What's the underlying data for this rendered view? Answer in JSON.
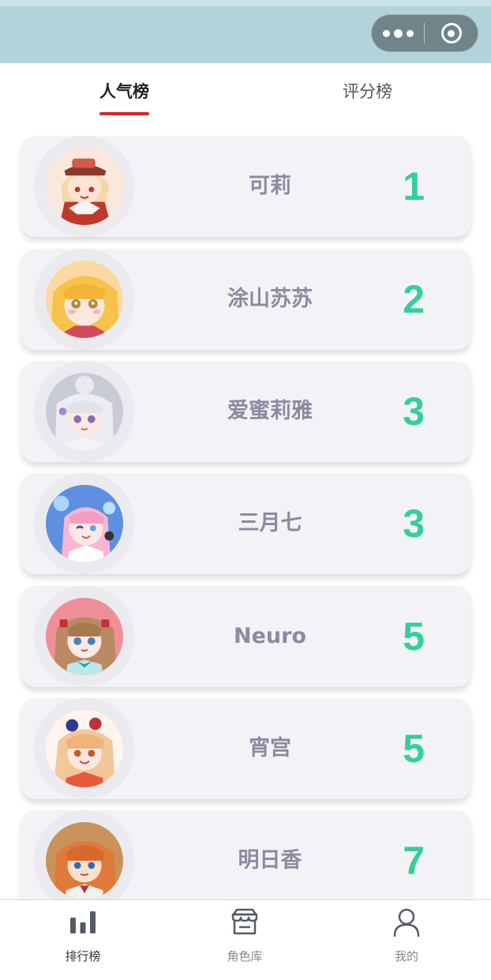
{
  "tabs": [
    {
      "label": "人气榜",
      "active": true
    },
    {
      "label": "评分榜",
      "active": false
    }
  ],
  "accent_color": "#d9232e",
  "rank_color": "#35cf98",
  "rankings": [
    {
      "name": "可莉",
      "rank": "1"
    },
    {
      "name": "涂山苏苏",
      "rank": "2"
    },
    {
      "name": "爱蜜莉雅",
      "rank": "3"
    },
    {
      "name": "三月七",
      "rank": "3"
    },
    {
      "name": "Neuro",
      "rank": "5"
    },
    {
      "name": "宵宫",
      "rank": "5"
    },
    {
      "name": "明日香",
      "rank": "7"
    }
  ],
  "tab_bar": [
    {
      "label": "排行榜",
      "icon": "bar-chart-icon",
      "active": true
    },
    {
      "label": "角色库",
      "icon": "store-icon",
      "active": false
    },
    {
      "label": "我的",
      "icon": "user-icon",
      "active": false
    }
  ]
}
